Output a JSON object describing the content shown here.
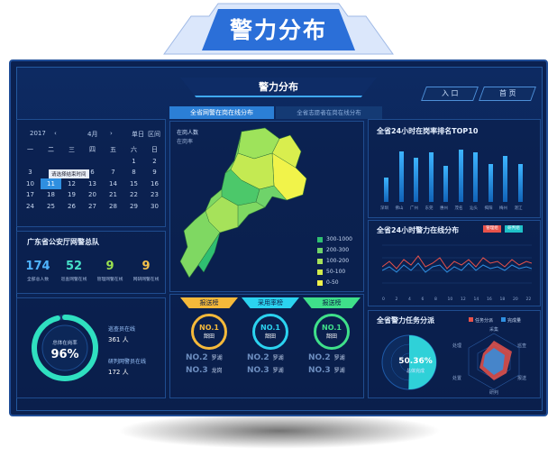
{
  "page": {
    "banner_title": "警力分布",
    "header_title": "警力分布",
    "nav": {
      "entry": "入 口",
      "home": "首 页"
    }
  },
  "tabs": {
    "active": "全省网警在岗在线分布",
    "inactive": "全省志愿者在岗在线分布"
  },
  "calendar": {
    "year": "2017",
    "month": "4月",
    "single": "单日",
    "range": "区间",
    "weekdays": [
      "一",
      "二",
      "三",
      "四",
      "五",
      "六",
      "日"
    ],
    "tooltip": "请选择结束时间",
    "rows": [
      [
        "",
        "",
        "",
        "",
        "",
        "1",
        "2"
      ],
      [
        "3",
        "4",
        "5",
        "6",
        "7",
        "8",
        "9"
      ],
      [
        "10",
        "11",
        "12",
        "13",
        "14",
        "15",
        "16"
      ],
      [
        "17",
        "18",
        "19",
        "20",
        "21",
        "22",
        "23"
      ],
      [
        "24",
        "25",
        "26",
        "27",
        "28",
        "29",
        "30"
      ]
    ],
    "selected": "11"
  },
  "team": {
    "title": "广东省公安厅网警总队",
    "stats": [
      {
        "value": "174",
        "label": "全部总人数",
        "color": "#4fb4ff"
      },
      {
        "value": "52",
        "label": "巡查网警在线",
        "color": "#46e0c8"
      },
      {
        "value": "9",
        "label": "管理网警在线",
        "color": "#9be24f"
      },
      {
        "value": "9",
        "label": "网研网警在线",
        "color": "#f5c24a"
      }
    ]
  },
  "online": {
    "gauge_label": "总体在岗率",
    "gauge_value": "96%",
    "gauge_fraction": 0.96,
    "lines": [
      {
        "title": "巡查员在线",
        "value": "361 人"
      },
      {
        "title": "研判网警员在线",
        "value": "172 人"
      }
    ]
  },
  "map": {
    "legend_title_1": "在岗人数",
    "legend_title_2": "在岗率",
    "scale": [
      "300-1000",
      "200-300",
      "100-200",
      "50-100",
      "0-50"
    ],
    "scale_colors": [
      "#2fbf71",
      "#6fd36a",
      "#a6e25a",
      "#d3ec4c",
      "#f1f34a"
    ]
  },
  "ranks": [
    {
      "tab": "报送榜",
      "color": "#f5b93a",
      "first": "NO.1",
      "first_city": "韶田",
      "no2": "NO.2",
      "no2_city": "罗湖",
      "no3": "NO.3",
      "no3_city": "龙岗"
    },
    {
      "tab": "采用率榜",
      "color": "#2bd3f0",
      "first": "NO.1",
      "first_city": "韶田",
      "no2": "NO.2",
      "no2_city": "罗湖",
      "no3": "NO.3",
      "no3_city": "罗湖"
    },
    {
      "tab": "报送榜",
      "color": "#3fe08a",
      "first": "NO.1",
      "first_city": "韶田",
      "no2": "NO.2",
      "no2_city": "罗湖",
      "no3": "NO.3",
      "no3_city": "罗湖"
    }
  ],
  "top10": {
    "title": "全省24小时在岗率排名TOP10",
    "cities": [
      "深圳",
      "佛山",
      "广州",
      "东莞",
      "惠州",
      "茂名",
      "汕头",
      "揭阳",
      "梅州",
      "湛江"
    ],
    "values": [
      0.42,
      0.88,
      0.76,
      0.86,
      0.62,
      0.9,
      0.86,
      0.66,
      0.8,
      0.66
    ]
  },
  "trend": {
    "title": "全省24小时警力在线分布",
    "legend": [
      "管理组",
      "研判组"
    ],
    "legend_colors": [
      "#e8524a",
      "#1fc1c8"
    ],
    "x_ticks": [
      "0",
      "2",
      "4",
      "6",
      "8",
      "10",
      "12",
      "14",
      "16",
      "18",
      "20",
      "22"
    ]
  },
  "tasks": {
    "title": "全省警力任务分派",
    "legend": [
      "任务分派",
      "完成量"
    ],
    "legend_colors": [
      "#e8524a",
      "#2f8fe0"
    ],
    "pie_value": "50.36%",
    "pie_fraction": 0.5036,
    "pie_label": "总体完成",
    "radar_axes": [
      "采集",
      "巡查",
      "报送",
      "研判",
      "处置",
      "处理"
    ]
  }
}
